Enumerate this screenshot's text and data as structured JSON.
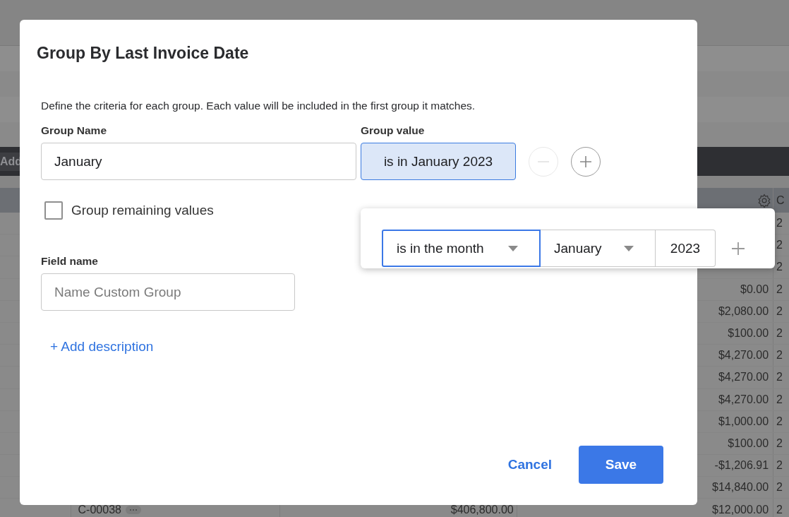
{
  "background": {
    "toolbar_button": "Add",
    "table": {
      "header": {
        "column_5": "C"
      },
      "rows": [
        {
          "column_5": "2"
        },
        {
          "column_5": "2"
        },
        {
          "column_5": "2"
        },
        {
          "column_4": "$0.00",
          "column_5": "2"
        },
        {
          "column_4": "$2,080.00",
          "column_5": "2"
        },
        {
          "column_4": "$100.00",
          "column_5": "2"
        },
        {
          "column_4": "$4,270.00",
          "column_5": "2"
        },
        {
          "column_4": "$4,270.00",
          "column_5": "2"
        },
        {
          "column_4": "$4,270.00",
          "column_5": "2"
        },
        {
          "column_4": "$1,000.00",
          "column_5": "2"
        },
        {
          "column_4": "$100.00",
          "column_5": "2"
        },
        {
          "column_4": "-$1,206.91",
          "column_5": "2"
        },
        {
          "column_4": "$14,840.00",
          "column_5": "2"
        },
        {
          "column_2": "C-00038",
          "column_3": "$406,800.00",
          "column_4": "$12,000.00",
          "column_5": "2"
        }
      ]
    }
  },
  "dialog": {
    "title": "Group By Last Invoice Date",
    "description": "Define the criteria for each group. Each value will be included in the first group it matches.",
    "group_name": {
      "label": "Group Name",
      "value": "January"
    },
    "group_value": {
      "label": "Group value",
      "value": "is in January 2023",
      "selected": true
    },
    "remove_button": {
      "disabled": true
    },
    "add_button": {
      "disabled": false
    },
    "remaining": {
      "label": "Group remaining values",
      "checked": false
    },
    "field_name": {
      "label": "Field name",
      "placeholder": "Name Custom Group"
    },
    "add_description": "+ Add description",
    "buttons": {
      "cancel": "Cancel",
      "save": "Save"
    }
  },
  "popup": {
    "condition": {
      "value": "is in the month",
      "focused": true
    },
    "month": {
      "value": "January"
    },
    "year": {
      "value": "2023"
    }
  }
}
